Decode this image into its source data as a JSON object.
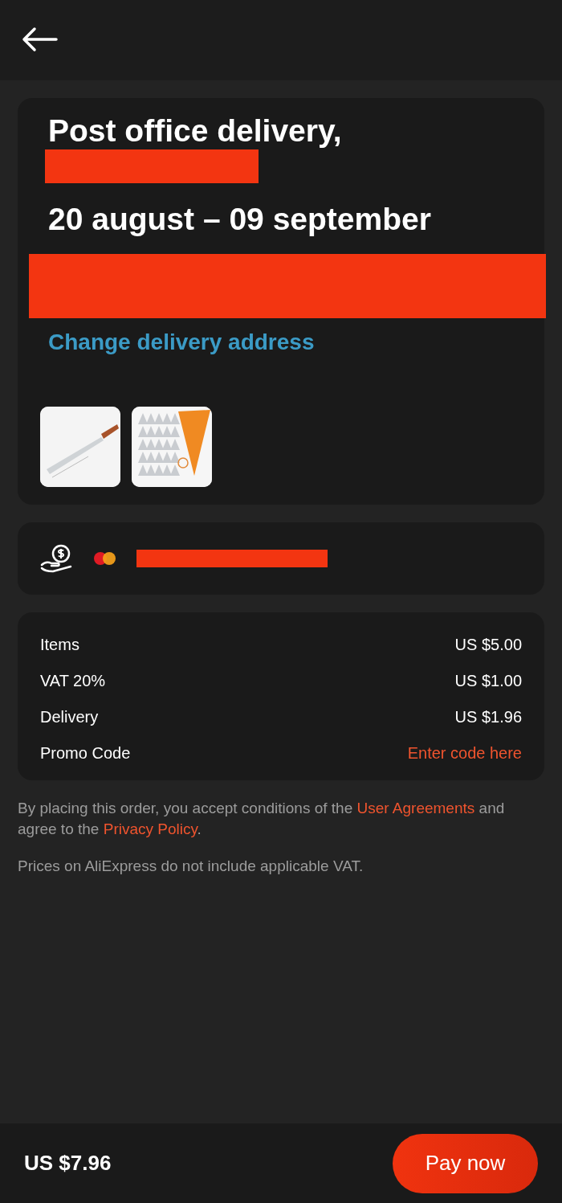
{
  "delivery": {
    "title": "Post office delivery,",
    "dates": "20 august – 09 september",
    "change_link": "Change delivery address"
  },
  "summary": {
    "rows": [
      {
        "kind": "amount",
        "label": "Items",
        "value": "US $5.00"
      },
      {
        "kind": "amount",
        "label": "VAT 20%",
        "value": "US $1.00"
      },
      {
        "kind": "amount",
        "label": "Delivery",
        "value": "US $1.96"
      },
      {
        "kind": "link",
        "label": "Promo Code",
        "value": "Enter code here"
      }
    ]
  },
  "legal": {
    "text_before": "By placing this order, you accept conditions of the",
    "agreements_link": "User Agreements",
    "text_middle": "and agree to the",
    "privacy_link": "Privacy Policy",
    "text_after": ".",
    "vat_note": "Prices on AliExpress do not include applicable VAT."
  },
  "footer": {
    "total": "US $7.96",
    "pay_button": "Pay now"
  }
}
